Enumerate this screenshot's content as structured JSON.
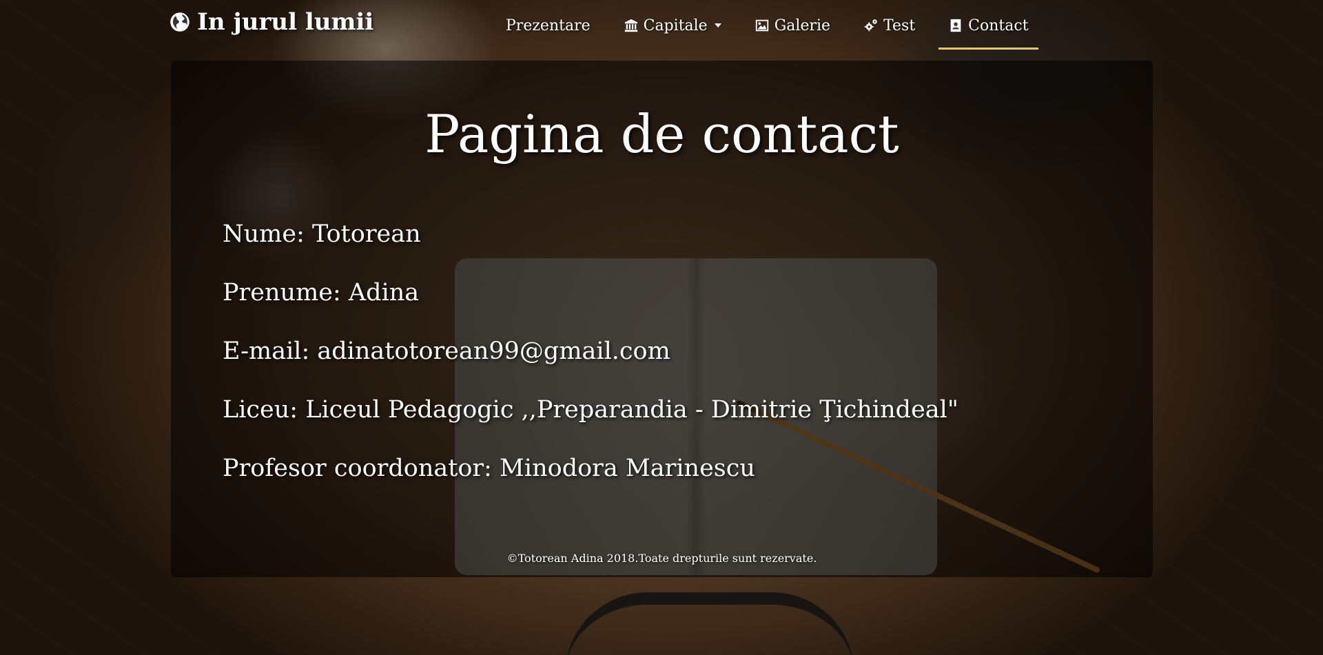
{
  "navbar": {
    "brand": {
      "icon": "globe-icon",
      "label": "In jurul lumii"
    },
    "items": [
      {
        "icon": "",
        "label": "Prezentare",
        "active": false
      },
      {
        "icon": "bank-icon",
        "label": "Capitale",
        "active": false,
        "dropdown": true
      },
      {
        "icon": "image-icon",
        "label": "Galerie",
        "active": false
      },
      {
        "icon": "gears-icon",
        "label": "Test",
        "active": false
      },
      {
        "icon": "contact-card-icon",
        "label": "Contact",
        "active": true
      }
    ],
    "active_underline_color": "#e6c96a"
  },
  "main": {
    "title": "Pagina de contact",
    "lines": [
      "Nume: Totorean",
      "Prenume: Adina",
      "E-mail: adinatotorean99@gmail.com",
      "Liceu: Liceul Pedagogic ,,Preparandia - Dimitrie Ţichindeal\"",
      "Profesor coordonator: Minodora Marinescu"
    ]
  },
  "footer": {
    "text": "©Totorean Adina 2018.Toate drepturile sunt rezervate."
  }
}
